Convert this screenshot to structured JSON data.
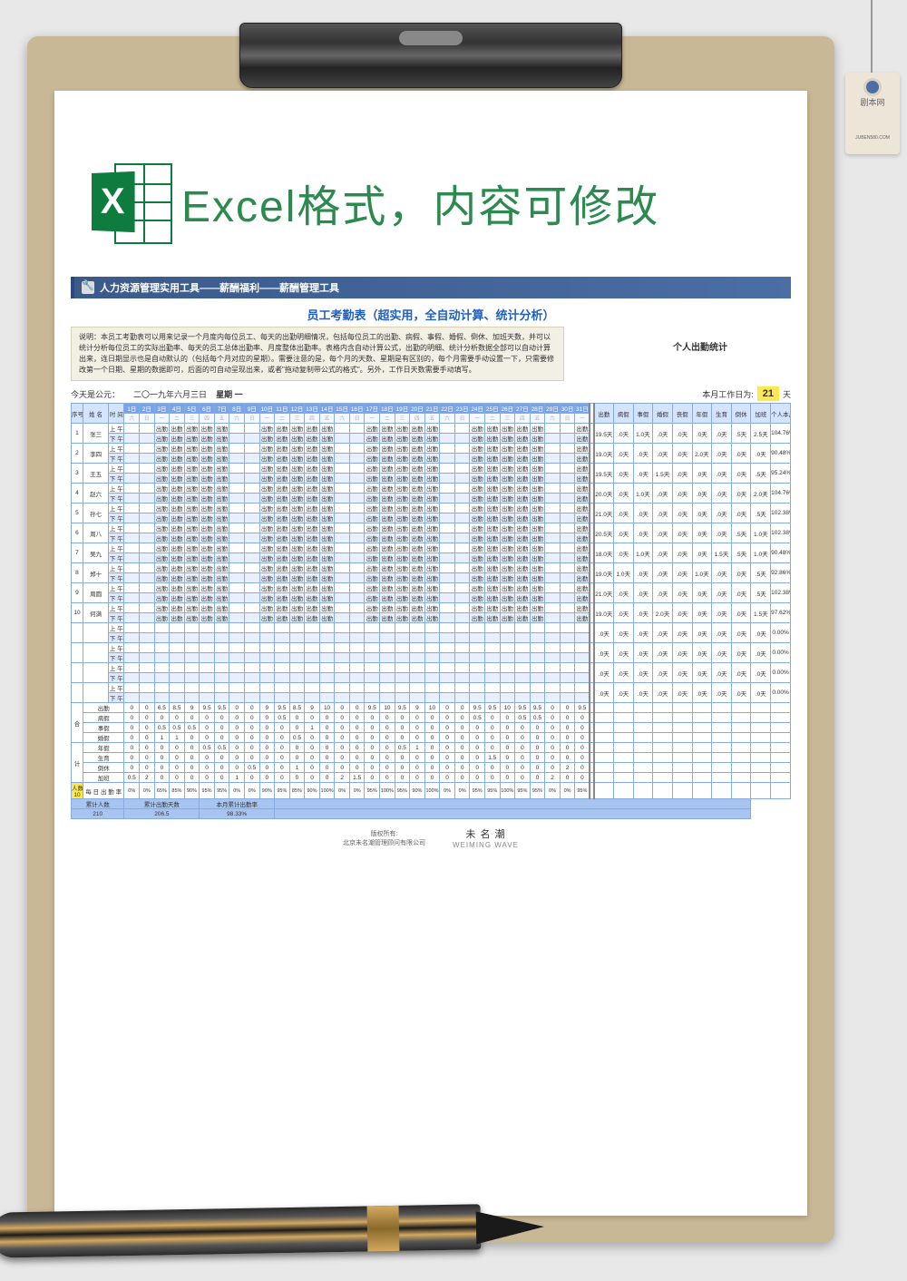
{
  "tag": {
    "line1": "剧本网",
    "line2": "JUBEN580.COM"
  },
  "header": {
    "title": "Excel格式，内容可修改",
    "icon_letter": "X"
  },
  "banner": "人力资源管理实用工具——薪酬福利——薪酬管理工具",
  "subtitle": "员工考勤表（超实用，全自动计算、统计分析）",
  "description": "说明：本员工考勤表可以用来记录一个月度内每位员工、每天的出勤明细情况，包括每位员工的出勤、病假、事假、婚假、倒休、加班天数，并可以统计分析每位员工的实际出勤率、每天的员工总体出勤率、月度整体出勤率。表格内含自动计算公式，出勤的明细、统计分析数据全部可以自动计算出来，连日期显示也是自动默认的（包括每个月对应的星期）。需要注意的是，每个月的天数、星期是有区别的，每个月需要手动设置一下，只需要修改第一个日期、星期的数据即可，后面的可自动呈现出来，或者\"拖动复制带公式的格式\"。另外，工作日天数需要手动填写。",
  "stat_title": "个人出勤统计",
  "date_row": {
    "today_label": "今天是公元：",
    "today_value": "二〇一九年六月三日",
    "weekday": "星期 一",
    "work_label": "本月工作日为:",
    "work_days": "21",
    "unit": "天"
  },
  "columns": {
    "idx": "序号",
    "name": "姓 名",
    "time": "时 间",
    "days": [
      "1日",
      "2日",
      "3日",
      "4日",
      "5日",
      "6日",
      "7日",
      "8日",
      "9日",
      "10日",
      "11日",
      "12日",
      "13日",
      "14日",
      "15日",
      "16日",
      "17日",
      "18日",
      "19日",
      "20日",
      "21日",
      "22日",
      "23日",
      "24日",
      "25日",
      "26日",
      "27日",
      "28日",
      "29日",
      "30日",
      "31日"
    ],
    "weekdays": [
      "六",
      "日",
      "一",
      "二",
      "三",
      "四",
      "五",
      "六",
      "日",
      "一",
      "二",
      "三",
      "四",
      "五",
      "六",
      "日",
      "一",
      "二",
      "三",
      "四",
      "五",
      "六",
      "日",
      "一",
      "二",
      "三",
      "四",
      "五",
      "六",
      "日",
      "一"
    ],
    "stats": [
      "出勤",
      "病假",
      "事假",
      "婚假",
      "丧假",
      "年假",
      "生育",
      "倒休",
      "加班",
      "个人本月出"
    ]
  },
  "am_label": "上 午",
  "pm_label": "下 午",
  "employees": [
    {
      "idx": "1",
      "name": "张三",
      "stats": [
        "19.5天",
        ".0天",
        "1.0天",
        ".0天",
        ".0天",
        ".0天",
        ".0天",
        ".5天",
        "2.5天",
        "104.76%"
      ]
    },
    {
      "idx": "2",
      "name": "李四",
      "stats": [
        "19.0天",
        ".0天",
        ".0天",
        ".0天",
        ".0天",
        "2.0天",
        ".0天",
        ".0天",
        ".0天",
        "90.48%"
      ]
    },
    {
      "idx": "3",
      "name": "王五",
      "stats": [
        "19.5天",
        ".0天",
        ".0天",
        "1.5天",
        ".0天",
        ".0天",
        ".0天",
        ".0天",
        ".5天",
        "95.24%"
      ]
    },
    {
      "idx": "4",
      "name": "赵六",
      "stats": [
        "20.0天",
        ".0天",
        "1.0天",
        ".0天",
        ".0天",
        ".0天",
        ".0天",
        ".0天",
        "2.0天",
        "104.76%"
      ]
    },
    {
      "idx": "5",
      "name": "孙七",
      "stats": [
        "21.0天",
        ".0天",
        ".0天",
        ".0天",
        ".0天",
        ".0天",
        ".0天",
        ".0天",
        ".5天",
        "102.38%"
      ]
    },
    {
      "idx": "6",
      "name": "周八",
      "stats": [
        "20.5天",
        ".0天",
        ".0天",
        ".0天",
        ".0天",
        ".0天",
        ".0天",
        ".5天",
        "1.0天",
        "102.38%"
      ]
    },
    {
      "idx": "7",
      "name": "吴九",
      "stats": [
        "18.0天",
        ".0天",
        "1.0天",
        ".0天",
        ".0天",
        ".0天",
        "1.5天",
        ".5天",
        "1.0天",
        "90.48%"
      ]
    },
    {
      "idx": "8",
      "name": "郑十",
      "stats": [
        "19.0天",
        "1.0天",
        ".0天",
        ".0天",
        ".0天",
        "1.0天",
        ".0天",
        ".0天",
        ".5天",
        "92.86%"
      ]
    },
    {
      "idx": "9",
      "name": "周圆",
      "stats": [
        "21.0天",
        ".0天",
        ".0天",
        ".0天",
        ".0天",
        ".0天",
        ".0天",
        ".0天",
        ".5天",
        "102.38%"
      ]
    },
    {
      "idx": "10",
      "name": "何满",
      "stats": [
        "19.0天",
        ".0天",
        ".0天",
        "2.0天",
        ".0天",
        ".0天",
        ".0天",
        ".0天",
        "1.5天",
        "97.62%"
      ]
    },
    {
      "idx": "",
      "name": "",
      "stats": [
        ".0天",
        ".0天",
        ".0天",
        ".0天",
        ".0天",
        ".0天",
        ".0天",
        ".0天",
        ".0天",
        "0.00%"
      ]
    },
    {
      "idx": "",
      "name": "",
      "stats": [
        ".0天",
        ".0天",
        ".0天",
        ".0天",
        ".0天",
        ".0天",
        ".0天",
        ".0天",
        ".0天",
        "0.00%"
      ]
    },
    {
      "idx": "",
      "name": "",
      "stats": [
        ".0天",
        ".0天",
        ".0天",
        ".0天",
        ".0天",
        ".0天",
        ".0天",
        ".0天",
        ".0天",
        "0.00%"
      ]
    },
    {
      "idx": "",
      "name": "",
      "stats": [
        ".0天",
        ".0天",
        ".0天",
        ".0天",
        ".0天",
        ".0天",
        ".0天",
        ".0天",
        ".0天",
        "0.00%"
      ]
    }
  ],
  "att_text": "出勤",
  "summary": {
    "label_top": "合",
    "label_bottom": "计",
    "rows": [
      {
        "label": "出勤",
        "vals": [
          "0",
          "0",
          "6.5",
          "8.5",
          "9",
          "9.5",
          "9.5",
          "0",
          "0",
          "9",
          "9.5",
          "8.5",
          "9",
          "10",
          "0",
          "0",
          "9.5",
          "10",
          "9.5",
          "9",
          "10",
          "0",
          "0",
          "9.5",
          "9.5",
          "10",
          "9.5",
          "9.5",
          "0",
          "0",
          "9.5"
        ]
      },
      {
        "label": "病假",
        "vals": [
          "0",
          "0",
          "0",
          "0",
          "0",
          "0",
          "0",
          "0",
          "0",
          "0",
          "0.5",
          "0",
          "0",
          "0",
          "0",
          "0",
          "0",
          "0",
          "0",
          "0",
          "0",
          "0",
          "0",
          "0.5",
          "0",
          "0",
          "0.5",
          "0.5",
          "0",
          "0",
          "0"
        ]
      },
      {
        "label": "事假",
        "vals": [
          "0",
          "0",
          "0.5",
          "0.5",
          "0.5",
          "0",
          "0",
          "0",
          "0",
          "0",
          "0",
          "0",
          "1",
          "0",
          "0",
          "0",
          "0",
          "0",
          "0",
          "0",
          "0",
          "0",
          "0",
          "0",
          "0",
          "0",
          "0",
          "0",
          "0",
          "0",
          "0"
        ]
      },
      {
        "label": "婚假",
        "vals": [
          "0",
          "0",
          "1",
          "1",
          "0",
          "0",
          "0",
          "0",
          "0",
          "0",
          "0",
          "0.5",
          "0",
          "0",
          "0",
          "0",
          "0",
          "0",
          "0",
          "0",
          "0",
          "0",
          "0",
          "0",
          "0",
          "0",
          "0",
          "0",
          "0",
          "0",
          "0"
        ]
      },
      {
        "label": "年假",
        "vals": [
          "0",
          "0",
          "0",
          "0",
          "0",
          "0.5",
          "0.5",
          "0",
          "0",
          "0",
          "0",
          "0",
          "0",
          "0",
          "0",
          "0",
          "0",
          "0",
          "0.5",
          "1",
          "0",
          "0",
          "0",
          "0",
          "0",
          "0",
          "0",
          "0",
          "0",
          "0",
          "0"
        ]
      },
      {
        "label": "生育",
        "vals": [
          "0",
          "0",
          "0",
          "0",
          "0",
          "0",
          "0",
          "0",
          "0",
          "0",
          "0",
          "0",
          "0",
          "0",
          "0",
          "0",
          "0",
          "0",
          "0",
          "0",
          "0",
          "0",
          "0",
          "0",
          "1.5",
          "0",
          "0",
          "0",
          "0",
          "0",
          "0"
        ]
      },
      {
        "label": "倒休",
        "vals": [
          "0",
          "0",
          "0",
          "0",
          "0",
          "0",
          "0",
          "0",
          "0.5",
          "0",
          "0",
          "1",
          "0",
          "0",
          "0",
          "0",
          "0",
          "0",
          "0",
          "0",
          "0",
          "0",
          "0",
          "0",
          "0",
          "0",
          "0",
          "0",
          "0",
          "2",
          "0"
        ]
      },
      {
        "label": "加班",
        "vals": [
          "0.5",
          "2",
          "0",
          "0",
          "0",
          "0",
          "0",
          "1",
          "0",
          "0",
          "0",
          "0",
          "0",
          "0",
          "2",
          "1.5",
          "0",
          "0",
          "0",
          "0",
          "0",
          "0",
          "0",
          "0",
          "0",
          "0",
          "0",
          "0",
          "2",
          "0",
          "0"
        ]
      }
    ],
    "people_label": "人数",
    "people_count": "10",
    "daily_label": "每 日\n出 勤 率",
    "daily_rates": [
      "0%",
      "0%",
      "65%",
      "85%",
      "90%",
      "95%",
      "95%",
      "0%",
      "0%",
      "90%",
      "95%",
      "85%",
      "90%",
      "100%",
      "0%",
      "0%",
      "95%",
      "100%",
      "95%",
      "90%",
      "100%",
      "0%",
      "0%",
      "95%",
      "95%",
      "100%",
      "95%",
      "95%",
      "0%",
      "0%",
      "95%"
    ]
  },
  "footer": {
    "cum_people_label": "累计人数",
    "cum_people": "210",
    "cum_days_label": "累计出勤天数",
    "cum_days": "206.5",
    "cum_rate_label": "本月累计出勤率",
    "cum_rate": "98.33%"
  },
  "copyright_label": "版权所有:",
  "copyright": "北京未名潮管理顾问有限公司",
  "brand": "未 名 潮",
  "brand_en": "WEIMING WAVE"
}
